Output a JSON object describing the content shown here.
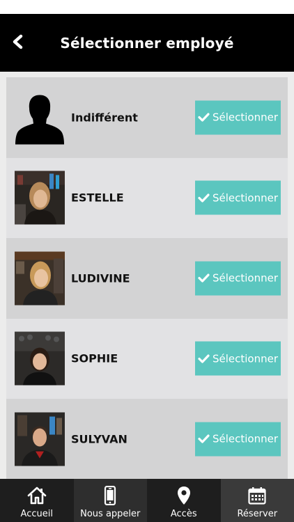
{
  "header": {
    "title": "Sélectionner employé",
    "back_icon": "chevron-left-icon"
  },
  "employees": [
    {
      "name": "Indifférent",
      "avatar": "silhouette",
      "button_label": "Sélectionner"
    },
    {
      "name": "ESTELLE",
      "avatar": "photo",
      "button_label": "Sélectionner"
    },
    {
      "name": "LUDIVINE",
      "avatar": "photo",
      "button_label": "Sélectionner"
    },
    {
      "name": "SOPHIE",
      "avatar": "photo",
      "button_label": "Sélectionner"
    },
    {
      "name": "SULYVAN",
      "avatar": "photo",
      "button_label": "Sélectionner"
    }
  ],
  "nav": [
    {
      "label": "Accueil",
      "icon": "home-icon"
    },
    {
      "label": "Nous appeler",
      "icon": "phone-icon"
    },
    {
      "label": "Accès",
      "icon": "map-pin-icon"
    },
    {
      "label": "Réserver",
      "icon": "calendar-icon"
    }
  ],
  "colors": {
    "accent": "#5bc6bf",
    "header": "#000000",
    "row_dark": "#d3d3d4",
    "row_light": "#e2e2e4"
  }
}
